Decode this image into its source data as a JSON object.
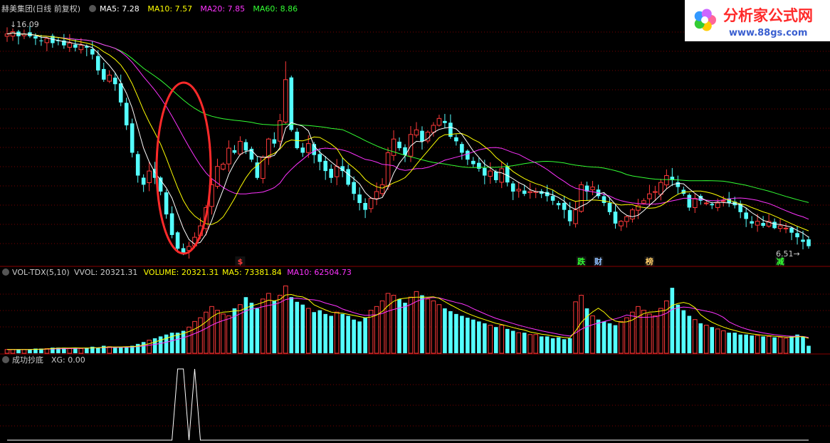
{
  "colors": {
    "up": "#ff3a3a",
    "down": "#54ffff",
    "ma5": "#ffffff",
    "ma10": "#ffff00",
    "ma20": "#ff33ff",
    "ma60": "#33ff33",
    "vol_ma5": "#ffff00",
    "vol_ma10": "#ff33ff",
    "circle": "#ff2a2a",
    "grid": "#7a0000",
    "xg_line": "#ffffff",
    "marker_red": "#ff3a3a",
    "marker_green": "#33ff33",
    "marker_blue": "#8fbfff",
    "marker_yellow": "#ffcc66"
  },
  "main_panel": {
    "title": "赫美集团(日线 前复权)",
    "indicators": [
      {
        "label": "MA5: 7.28",
        "color": "#ffffff"
      },
      {
        "label": "MA10: 7.57",
        "color": "#ffff00"
      },
      {
        "label": "MA20: 7.85",
        "color": "#ff33ff"
      },
      {
        "label": "MA60: 8.86",
        "color": "#33ff33"
      }
    ],
    "high_label": "16.09",
    "low_label": "6.51",
    "markers": [
      {
        "text": "$",
        "color": "#ff3a3a",
        "idx": 41
      },
      {
        "text": "跌",
        "color": "#33ff33",
        "idx": 101
      },
      {
        "text": "财",
        "color": "#8fbfff",
        "idx": 104
      },
      {
        "text": "榜",
        "color": "#ffcc66",
        "idx": 113
      },
      {
        "text": "减",
        "color": "#33ff33",
        "idx": 136
      }
    ]
  },
  "vol_panel": {
    "title": "VOL-TDX(5,10)",
    "indicators": [
      {
        "label": "VVOL: 20321.31",
        "color": "#cccccc"
      },
      {
        "label": "VOLUME: 20321.31",
        "color": "#ffff00"
      },
      {
        "label": "MA5: 73381.84",
        "color": "#ffff00"
      },
      {
        "label": "MA10: 62504.73",
        "color": "#ff33ff"
      }
    ]
  },
  "xg_panel": {
    "title": "成功抄底",
    "indicators": [
      {
        "label": "XG: 0.00",
        "color": "#cccccc"
      }
    ]
  },
  "logo": {
    "text": "分析家公式网",
    "url": "www.88gs.com"
  },
  "chart_data": {
    "type": "candlestick",
    "y_range": [
      6.0,
      16.6
    ],
    "closes": [
      15.8,
      15.9,
      15.7,
      15.8,
      15.7,
      15.6,
      15.5,
      15.6,
      15.4,
      15.5,
      15.3,
      15.4,
      15.2,
      15.3,
      15.2,
      14.9,
      14.2,
      13.8,
      14.0,
      13.6,
      12.8,
      11.8,
      10.6,
      9.6,
      9.2,
      9.8,
      9.5,
      8.9,
      7.9,
      7.0,
      6.4,
      6.2,
      6.5,
      6.9,
      7.4,
      8.2,
      9.2,
      10.0,
      10.1,
      10.8,
      10.6,
      11.1,
      10.7,
      10.3,
      9.5,
      10.4,
      11.2,
      11.0,
      12.0,
      13.8,
      11.6,
      10.8,
      10.6,
      11.0,
      10.5,
      10.2,
      9.8,
      9.5,
      10.0,
      9.8,
      9.2,
      8.8,
      8.4,
      8.1,
      8.6,
      8.9,
      9.2,
      10.6,
      11.2,
      10.8,
      10.5,
      11.4,
      11.6,
      11.1,
      11.5,
      11.8,
      12.1,
      11.9,
      11.3,
      11.1,
      10.6,
      10.3,
      10.1,
      9.9,
      9.6,
      9.8,
      9.4,
      9.9,
      9.3,
      8.9,
      9.0,
      8.8,
      8.9,
      8.9,
      8.8,
      8.7,
      8.5,
      8.3,
      8.1,
      7.6,
      8.1,
      9.2,
      8.9,
      9.1,
      8.7,
      8.4,
      8.0,
      7.5,
      7.6,
      7.8,
      8.1,
      8.3,
      8.5,
      8.8,
      8.9,
      9.3,
      9.6,
      9.4,
      9.1,
      8.8,
      8.2,
      8.6,
      8.5,
      8.4,
      8.3,
      8.4,
      8.5,
      8.4,
      8.3,
      8.0,
      7.7,
      7.5,
      7.6,
      7.4,
      7.6,
      7.3,
      7.4,
      7.3,
      7.1,
      6.9,
      6.7,
      6.51
    ],
    "volumes": [
      4,
      4,
      4,
      4,
      4,
      5,
      5,
      5,
      6,
      6,
      6,
      5,
      6,
      5,
      6,
      7,
      6,
      8,
      7,
      6,
      7,
      7,
      8,
      10,
      12,
      14,
      16,
      18,
      20,
      22,
      22,
      24,
      28,
      34,
      38,
      44,
      50,
      46,
      42,
      40,
      48,
      52,
      60,
      54,
      48,
      58,
      64,
      56,
      62,
      72,
      60,
      55,
      52,
      48,
      44,
      46,
      42,
      40,
      44,
      42,
      40,
      36,
      34,
      38,
      46,
      50,
      56,
      64,
      62,
      58,
      54,
      60,
      66,
      62,
      58,
      56,
      52,
      48,
      45,
      42,
      40,
      38,
      36,
      34,
      32,
      30,
      28,
      30,
      26,
      24,
      22,
      22,
      20,
      20,
      18,
      18,
      16,
      17,
      15,
      16,
      55,
      62,
      48,
      40,
      36,
      34,
      32,
      30,
      34,
      38,
      44,
      50,
      46,
      42,
      40,
      48,
      56,
      70,
      52,
      46,
      40,
      36,
      32,
      30,
      28,
      26,
      24,
      22,
      22,
      20,
      20,
      19,
      19,
      18,
      18,
      17,
      17,
      16,
      18,
      20,
      18,
      8
    ]
  }
}
